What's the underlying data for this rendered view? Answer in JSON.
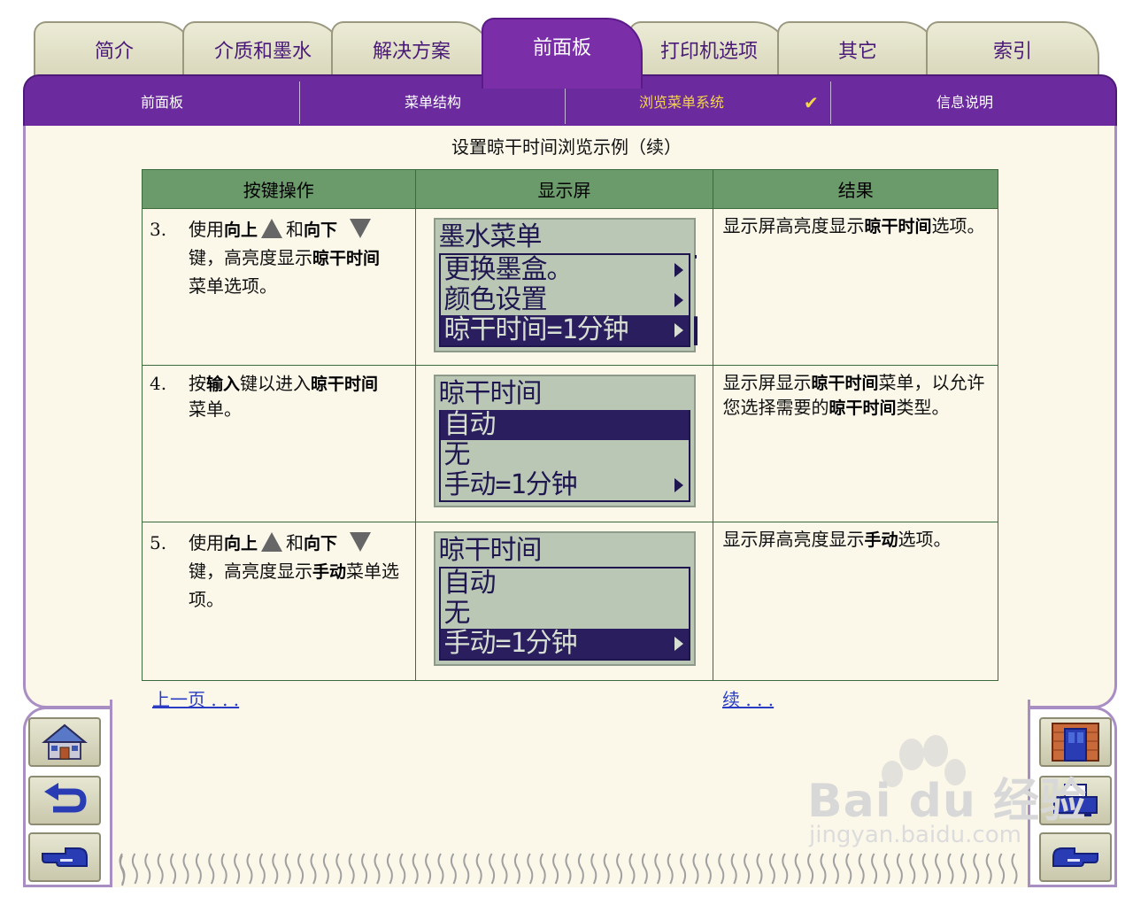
{
  "tabs": [
    {
      "label": "简介"
    },
    {
      "label": "介质和墨水"
    },
    {
      "label": "解决方案"
    },
    {
      "label": "前面板"
    },
    {
      "label": "打印机选项"
    },
    {
      "label": "其它"
    },
    {
      "label": "索引"
    }
  ],
  "active_tab": "前面板",
  "subnav": [
    {
      "label": "前面板"
    },
    {
      "label": "菜单结构"
    },
    {
      "label": "浏览菜单系统"
    },
    {
      "label": "信息说明"
    }
  ],
  "subnav_check": "✔",
  "page_title": "设置晾干时间浏览示例（续）",
  "table": {
    "headers": [
      "按键操作",
      "显示屏",
      "结果"
    ],
    "rows": [
      {
        "num": "3.",
        "a1": "使用",
        "b1": "向上",
        "a2": "和",
        "b2": "向下",
        "a3": "键，高亮度显示",
        "b3": "晾干时间",
        "a4": "菜单选项。",
        "lcd": {
          "title": "墨水菜单",
          "items": [
            "更换墨盒。",
            "颜色设置",
            "晾干时间=1分钟"
          ]
        },
        "r1": "显示屏高亮度显示",
        "rb1": "晾干时间",
        "r2": "选项。"
      },
      {
        "num": "4.",
        "a1": "按",
        "b1": "输入",
        "a2": "键以进入",
        "b2": "晾干时间",
        "a3": "菜单。",
        "lcd": {
          "title": "晾干时间",
          "items": [
            "自动",
            "无",
            "手动=1分钟"
          ]
        },
        "r1": "显示屏显示",
        "rb1": "晾干时间",
        "r2": "菜单，以允许您选择需要的",
        "rb2": "晾干时间",
        "r3": "类型。"
      },
      {
        "num": "5.",
        "a1": "使用",
        "b1": "向上",
        "a2": "和",
        "b2": "向下",
        "a3": "键，高亮度显示",
        "b3": "手动",
        "a4": "菜单选项。",
        "lcd": {
          "title": "晾干时间",
          "items": [
            "自动",
            "无",
            "手动=1分钟"
          ]
        },
        "r1": "显示屏高亮度显示",
        "rb1": "手动",
        "r2": "选项。"
      }
    ]
  },
  "links": {
    "prev": "上一页 . . .",
    "next": "续 . . ."
  },
  "watermark": {
    "brand": "Bai du 经验",
    "url": "jingyan.baidu.com"
  },
  "icons": [
    "home-icon",
    "back-icon",
    "previous-hand-icon",
    "door-icon",
    "printer-icon",
    "next-hand-icon"
  ],
  "colors": {
    "purple": "#6b2b9e",
    "cream": "#fbf8ea",
    "header_green": "#6b9a6b",
    "highlight_yellow": "#f6d54a",
    "lcd": "#b9c7b4"
  }
}
